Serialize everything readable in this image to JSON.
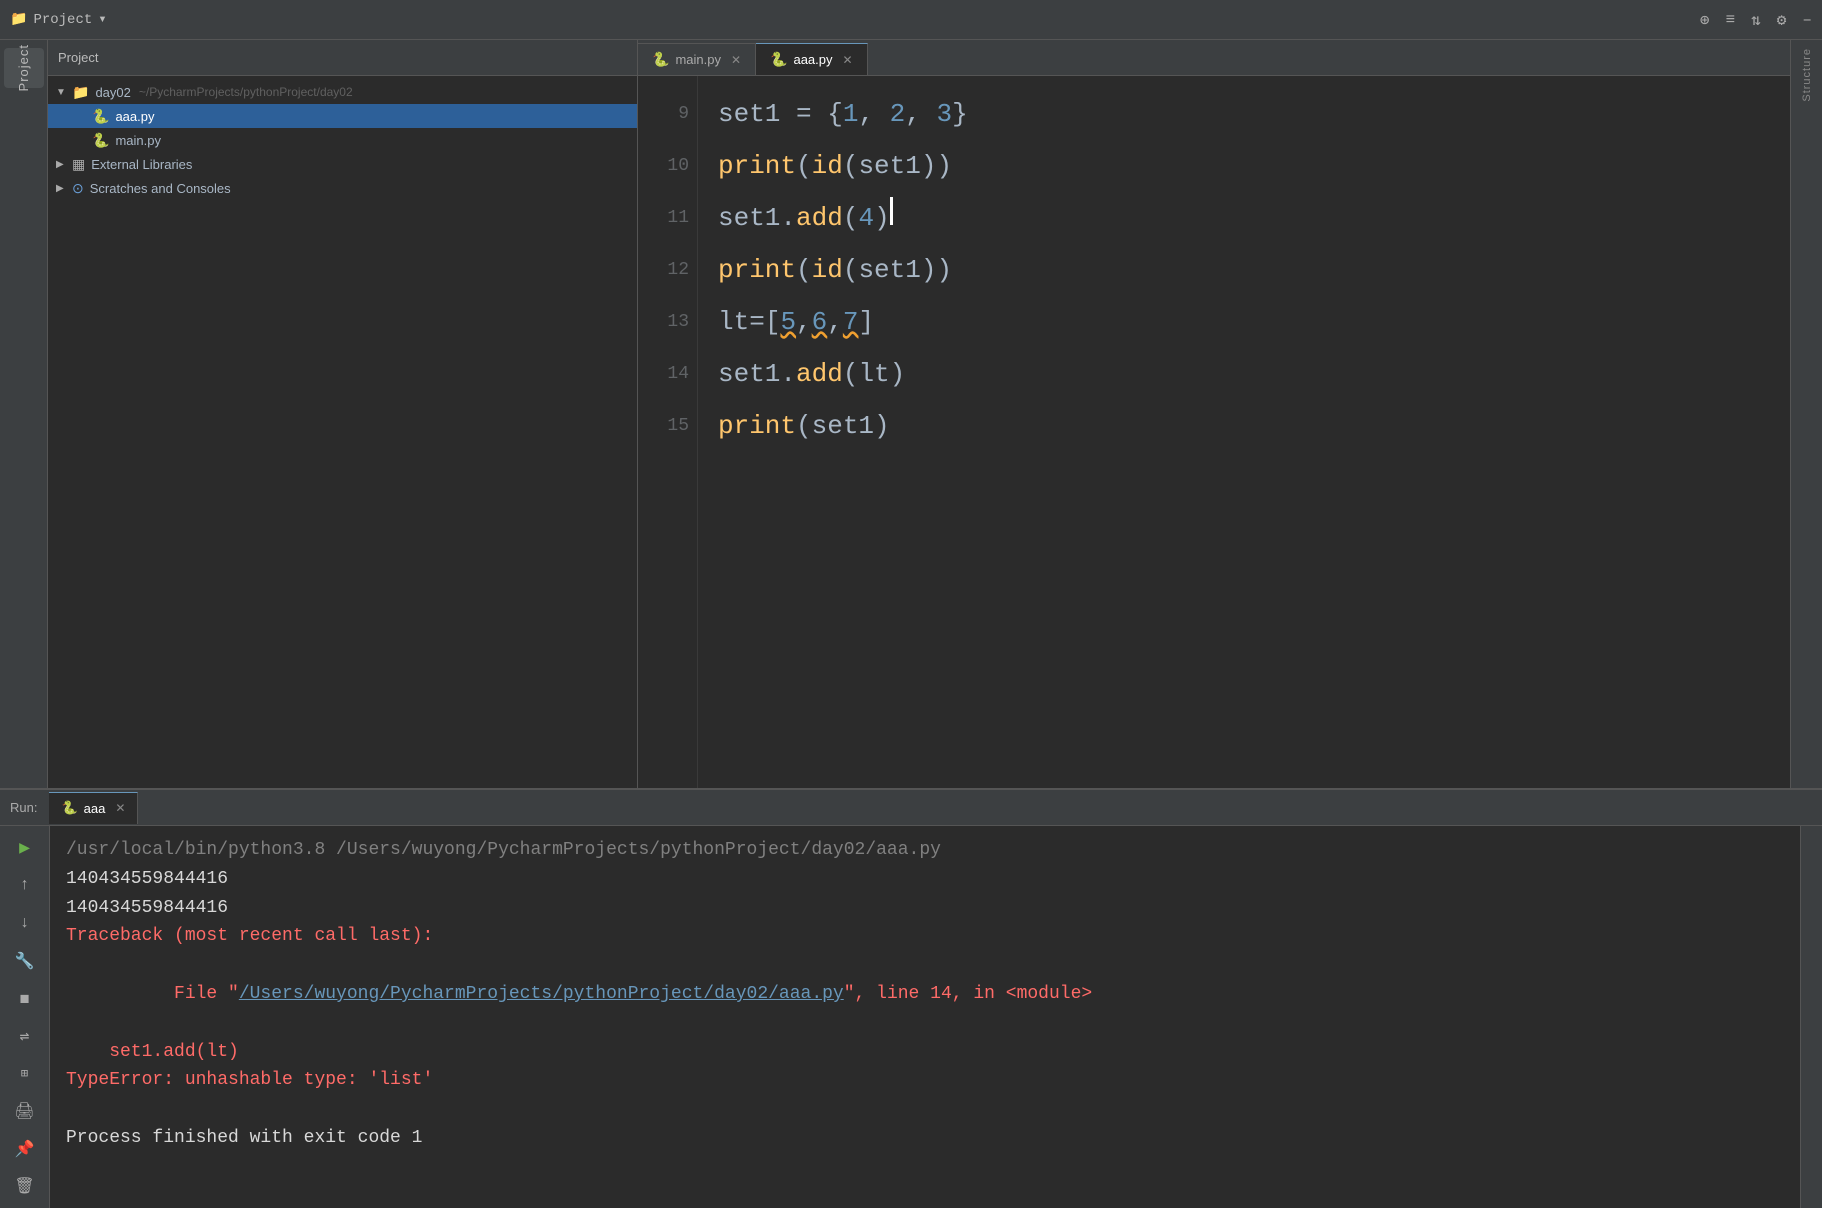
{
  "topbar": {
    "project_label": "Project",
    "icons": [
      "⊕",
      "≡",
      "↕",
      "⚙",
      "–"
    ]
  },
  "sidebar_strip": {
    "items": [
      {
        "icon": "📁",
        "label": "project-icon",
        "active": true
      },
      {
        "icon": "🔍",
        "label": "search-icon",
        "active": false
      }
    ]
  },
  "project_panel": {
    "title": "Project",
    "tree": [
      {
        "level": 0,
        "type": "folder",
        "label": "day02",
        "path": "~/PycharmProjects/pythonProject/day02",
        "expanded": true,
        "arrow": "▼"
      },
      {
        "level": 1,
        "type": "py",
        "label": "aaa.py",
        "selected": true
      },
      {
        "level": 1,
        "type": "py",
        "label": "main.py",
        "selected": false
      },
      {
        "level": 0,
        "type": "lib",
        "label": "External Libraries",
        "expanded": false,
        "arrow": "▶"
      },
      {
        "level": 0,
        "type": "scratch",
        "label": "Scratches and Consoles",
        "expanded": false,
        "arrow": "▶"
      }
    ]
  },
  "editor": {
    "tabs": [
      {
        "label": "main.py",
        "active": false,
        "icon_color": "yellow"
      },
      {
        "label": "aaa.py",
        "active": true,
        "icon_color": "blue"
      }
    ],
    "lines": [
      {
        "num": 9,
        "code": "set1 = {1, 2, 3}"
      },
      {
        "num": 10,
        "code": "print(id(set1))"
      },
      {
        "num": 11,
        "code": "set1.add(4)"
      },
      {
        "num": 12,
        "code": "print(id(set1))"
      },
      {
        "num": 13,
        "code": "lt=[5,6,7]"
      },
      {
        "num": 14,
        "code": "set1.add(lt)"
      },
      {
        "num": 15,
        "code": "print(set1)"
      }
    ]
  },
  "run_panel": {
    "label": "Run:",
    "tab": "aaa",
    "output": [
      {
        "text": "/usr/local/bin/python3.8 /Users/wuyong/PycharmProjects/pythonProject/day02/aaa.py",
        "style": "gray"
      },
      {
        "text": "140434559844416",
        "style": "white"
      },
      {
        "text": "140434559844416",
        "style": "white"
      },
      {
        "text": "Traceback (most recent call last):",
        "style": "red"
      },
      {
        "text": "  File \"/Users/wuyong/PycharmProjects/pythonProject/day02/aaa.py\", line 14, in <module>",
        "style": "red_link"
      },
      {
        "text": "    set1.add(lt)",
        "style": "red"
      },
      {
        "text": "TypeError: unhashable type: 'list'",
        "style": "red"
      },
      {
        "text": "",
        "style": "white"
      },
      {
        "text": "Process finished with exit code 1",
        "style": "white"
      }
    ]
  }
}
